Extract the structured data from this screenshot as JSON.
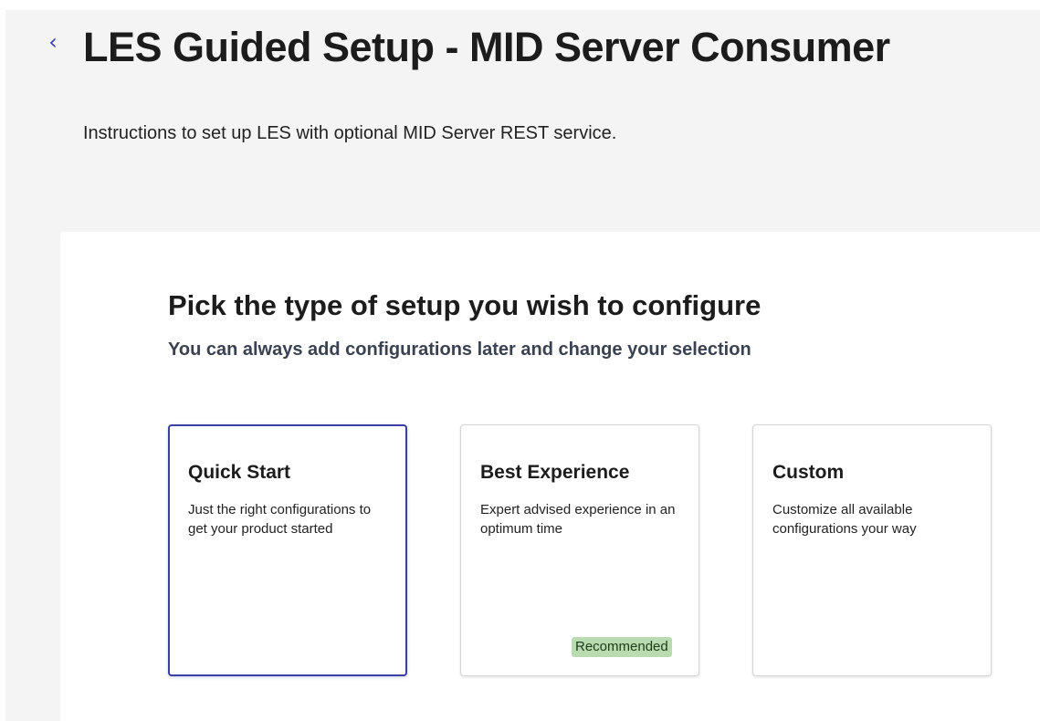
{
  "header": {
    "back_icon_glyph": "‹",
    "title": "LES Guided Setup - MID Server Consumer",
    "description": "Instructions to set up LES with optional MID Server REST service."
  },
  "setup": {
    "heading": "Pick the type of setup you wish to configure",
    "subheading": "You can always add configurations later and change your selection",
    "options": [
      {
        "title": "Quick Start",
        "description": "Just the right configurations to get your product started",
        "selected": true
      },
      {
        "title": "Best Experience",
        "description": "Expert advised experience in an optimum time",
        "badge": "Recommended",
        "selected": false
      },
      {
        "title": "Custom",
        "description": "Customize all available configurations your way",
        "selected": false
      }
    ]
  },
  "colors": {
    "accent": "#3b3fa6",
    "page_background": "#f4f4f4",
    "badge_background": "#b9dbb0"
  }
}
